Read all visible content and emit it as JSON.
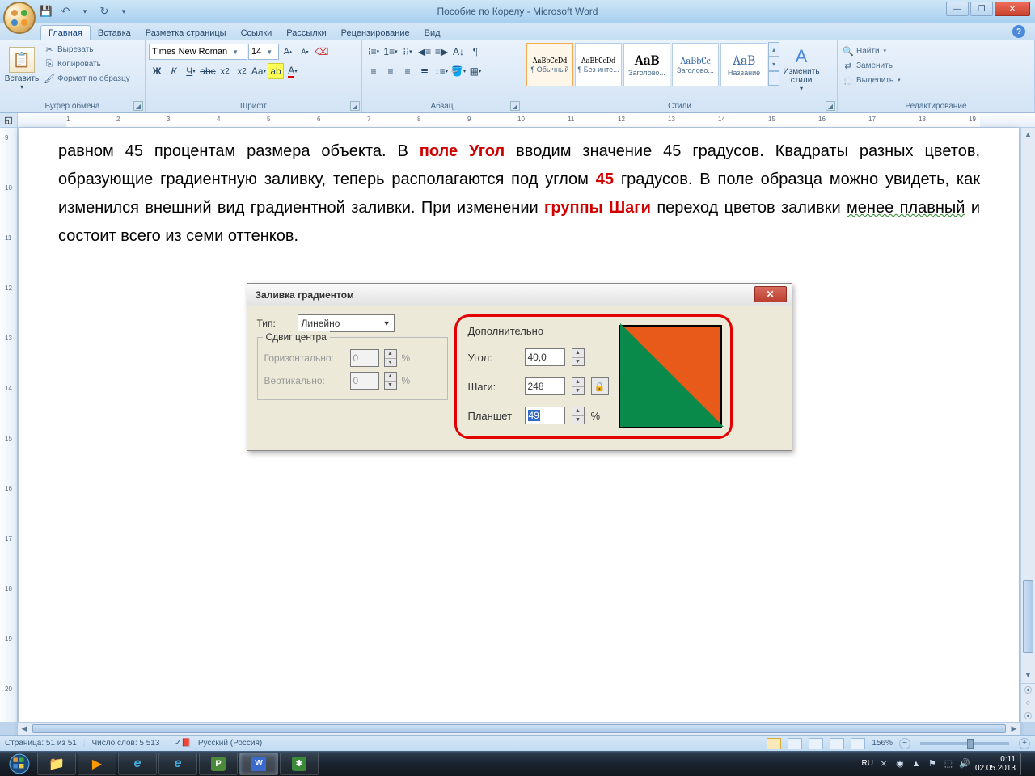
{
  "window": {
    "title": "Пособие по Корелу - Microsoft Word",
    "help_tooltip": "?"
  },
  "qat": {
    "save": "💾",
    "undo": "↶",
    "redo": "↻",
    "more": "▾"
  },
  "tabs": [
    "Главная",
    "Вставка",
    "Разметка страницы",
    "Ссылки",
    "Рассылки",
    "Рецензирование",
    "Вид"
  ],
  "active_tab": 0,
  "clipboard": {
    "paste": "Вставить",
    "cut": "Вырезать",
    "copy": "Копировать",
    "format_painter": "Формат по образцу",
    "group": "Буфер обмена"
  },
  "font": {
    "name": "Times New Roman",
    "size": "14",
    "group": "Шрифт"
  },
  "paragraph": {
    "group": "Абзац"
  },
  "styles": {
    "group": "Стили",
    "change": "Изменить стили",
    "items": [
      {
        "sample": "AaBbCcDd",
        "name": "¶ Обычный"
      },
      {
        "sample": "AaBbCcDd",
        "name": "¶ Без инте..."
      },
      {
        "sample": "AaB",
        "name": "Заголово...",
        "big": true
      },
      {
        "sample": "AaBbCc",
        "name": "Заголово...",
        "blue": true
      },
      {
        "sample": "AaB",
        "name": "Название",
        "big": true,
        "blue": true
      }
    ]
  },
  "editing": {
    "group": "Редактирование",
    "find": "Найти",
    "replace": "Заменить",
    "select": "Выделить"
  },
  "document": {
    "p1_a": "равном 45 процентам размера объекта. В ",
    "p1_b": "поле Угол",
    "p1_c": " вводим значение 45 градусов. Квадраты разных цветов, образующие градиентную заливку, теперь располагаются под углом ",
    "p1_d": "45",
    "p1_e": " градусов. В поле образца можно увидеть, как изменился внешний вид градиентной заливки. При изменении ",
    "p1_f": "группы Шаги",
    "p1_g": " переход цветов заливки ",
    "p1_h": "менее плавный",
    "p1_i": " и состоит всего из семи оттенков."
  },
  "dialog": {
    "title": "Заливка градиентом",
    "type_label": "Тип:",
    "type_value": "Линейно",
    "shift_legend": "Сдвиг центра",
    "horiz": "Горизонтально:",
    "vert": "Вертикально:",
    "zero": "0",
    "pct": "%",
    "extra": "Дополнительно",
    "angle": "Угол:",
    "angle_val": "40,0",
    "steps": "Шаги:",
    "steps_val": "248",
    "pad": "Планшет",
    "pad_val": "49"
  },
  "status": {
    "page": "Страница: 51 из 51",
    "words": "Число слов: 5 513",
    "lang": "Русский (Россия)",
    "zoom": "156%"
  },
  "tray": {
    "lang": "RU",
    "time": "0:11",
    "date": "02.05.2013"
  },
  "ruler_marks": [
    "1",
    "2",
    "3",
    "4",
    "5",
    "6",
    "7",
    "8",
    "9",
    "10",
    "11",
    "12",
    "13",
    "14",
    "15",
    "16",
    "17",
    "18",
    "19"
  ],
  "vruler_marks": [
    "9",
    "10",
    "11",
    "12",
    "13",
    "14",
    "15",
    "16",
    "17",
    "18",
    "19",
    "20"
  ]
}
